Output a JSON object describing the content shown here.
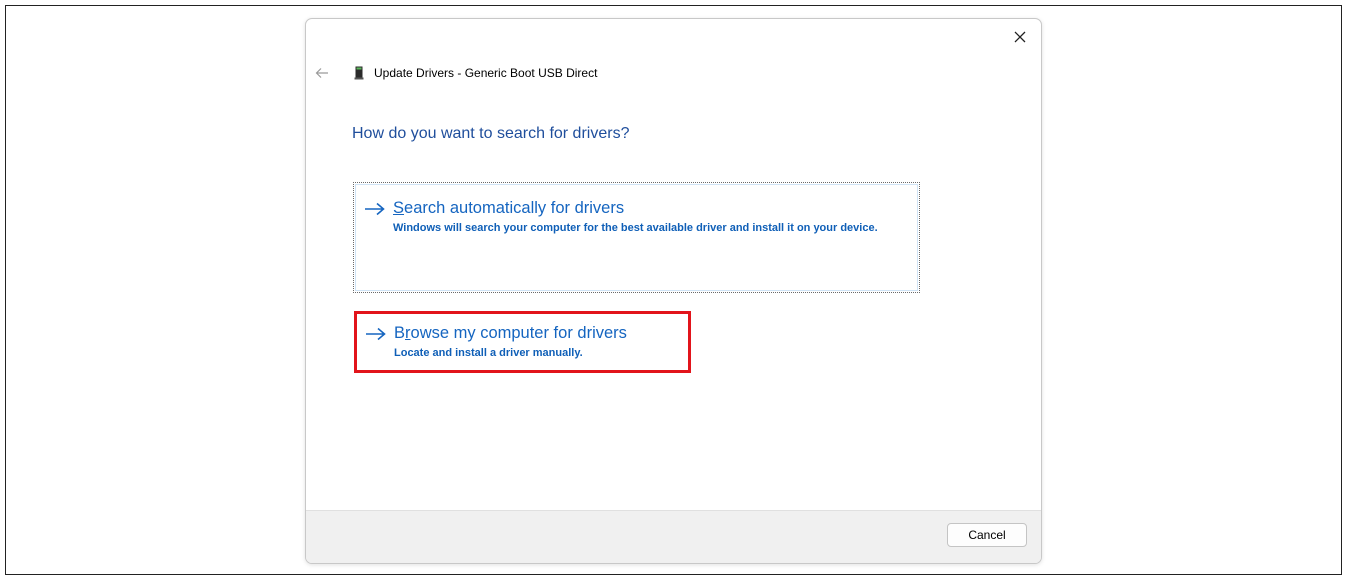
{
  "dialog": {
    "title": "Update Drivers - Generic Boot USB Direct",
    "heading": "How do you want to search for drivers?",
    "icons": {
      "close": "close-icon",
      "back": "back-arrow-icon",
      "device": "usb-device-icon",
      "option_arrow": "right-arrow-icon"
    },
    "options": [
      {
        "title_accesskey": "S",
        "title_rest": "earch automatically for drivers",
        "description": "Windows will search your computer for the best available driver and install it on your device."
      },
      {
        "title_first": "B",
        "title_accesskey": "r",
        "title_rest": "owse my computer for drivers",
        "description": "Locate and install a driver manually."
      }
    ],
    "cancel_label": "Cancel"
  },
  "colors": {
    "heading": "#1f4e9c",
    "link": "#1565c0",
    "highlight_box": "#e2141b",
    "footer": "#f0f0f0"
  }
}
